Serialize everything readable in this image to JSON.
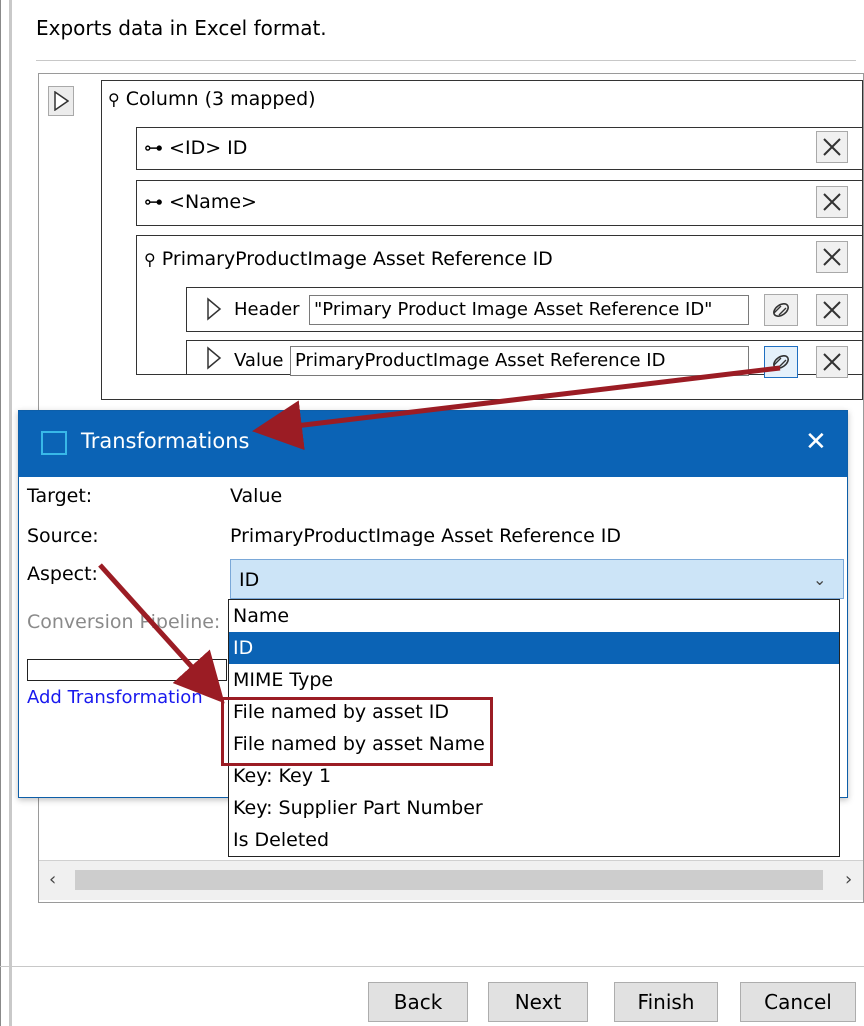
{
  "description": "Exports data in Excel format.",
  "column_group": {
    "label": "Column (3 mapped)",
    "items": [
      {
        "label": "<ID> ID"
      },
      {
        "label": "<Name>"
      },
      {
        "label": "PrimaryProductImage Asset Reference ID",
        "header": {
          "label": "Header",
          "value": "\"Primary Product Image Asset Reference ID\""
        },
        "value": {
          "label": "Value",
          "value": "PrimaryProductImage Asset Reference ID"
        }
      }
    ]
  },
  "dialog": {
    "title": "Transformations",
    "close": "✕",
    "target_label": "Target:",
    "target_value": "Value",
    "source_label": "Source:",
    "source_value": "PrimaryProductImage Asset Reference ID",
    "aspect_label": "Aspect:",
    "aspect_selected": "ID",
    "pipeline_label": "Conversion Pipeline:",
    "add_transformation": "Add Transformation"
  },
  "aspect_options": [
    "Name",
    "ID",
    "MIME Type",
    "File named by asset ID",
    "File named by asset Name",
    "Key: Key 1",
    "Key: Supplier Part Number",
    "Is Deleted"
  ],
  "buttons": {
    "back": "Back",
    "next": "Next",
    "finish": "Finish",
    "cancel": "Cancel"
  },
  "colors": {
    "accent": "#0b63b5",
    "highlight": "#9b1c24",
    "combo_bg": "#cce4f7"
  }
}
